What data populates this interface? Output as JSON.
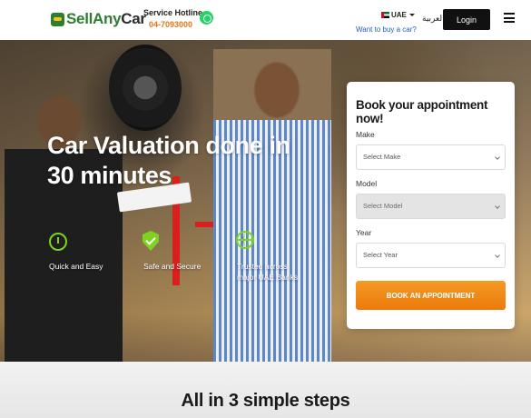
{
  "header": {
    "logo": {
      "sell": "Sell",
      "any": "Any",
      "car": "Car"
    },
    "hotline": {
      "title": "Service Hotline",
      "number": "04-7093000"
    },
    "country": {
      "label": "UAE"
    },
    "language_link": "العربية",
    "buy_link": "Want to buy a car?",
    "login_label": "Login",
    "icons": {
      "whatsapp": "whatsapp-icon",
      "menu": "hamburger-menu-icon",
      "flag": "uae-flag-icon"
    }
  },
  "hero": {
    "title": "Car Valuation done in 30 minutes",
    "features": [
      {
        "label": "Quick and Easy",
        "icon": "timer-icon"
      },
      {
        "label": "Safe and Secure",
        "icon": "shield-check-icon"
      },
      {
        "label": "Trusted across major UAE Banks",
        "icon": "globe-icon"
      }
    ]
  },
  "booking": {
    "title": "Book your appointment now!",
    "make": {
      "label": "Make",
      "placeholder": "Select Make"
    },
    "model": {
      "label": "Model",
      "placeholder": "Select Model"
    },
    "year": {
      "label": "Year",
      "placeholder": "Select Year"
    },
    "button_label": "BOOK AN APPOINTMENT"
  },
  "steps": {
    "title": "All in 3 simple steps"
  },
  "colors": {
    "brand_green": "#2e7d32",
    "accent_orange": "#ec7a0b",
    "icon_green": "#7ed321",
    "link_blue": "#1f5fbf"
  }
}
